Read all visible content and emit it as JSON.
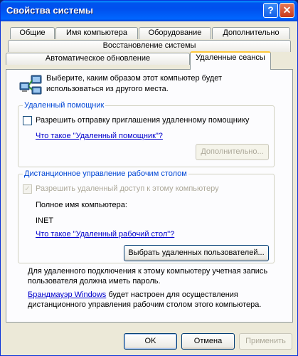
{
  "window": {
    "title": "Свойства системы"
  },
  "tabs_row1": [
    "Общие",
    "Имя компьютера",
    "Оборудование",
    "Дополнительно"
  ],
  "tabs_row2": [
    "Восстановление системы"
  ],
  "tabs_row3": [
    "Автоматическое обновление",
    "Удаленные сеансы"
  ],
  "active_tab": "Удаленные сеансы",
  "intro": {
    "line1": "Выберите, каким образом этот компьютер будет",
    "line2": "использоваться из другого места."
  },
  "assistance": {
    "title": "Удаленный помощник",
    "checkbox_label": "Разрешить отправку приглашения удаленному помощнику",
    "checked": false,
    "link": "Что такое \"Удаленный помощник\"?",
    "advanced_button": "Дополнительно..."
  },
  "remote_desktop": {
    "title": "Дистанционное управление рабочим столом",
    "checkbox_label": "Разрешить удаленный доступ к этому компьютеру",
    "checked": true,
    "full_name_label": "Полное имя компьютера:",
    "computer_name": "INET",
    "link": "Что такое \"Удаленный рабочий стол\"?",
    "select_users_button": "Выбрать удаленных пользователей..."
  },
  "notes": {
    "password_line1": "Для удаленного подключения к этому компьютеру учетная запись",
    "password_line2": "пользователя должна иметь пароль.",
    "firewall_link": "Брандмауэр Windows",
    "firewall_rest": " будет настроен для осуществления",
    "firewall_line2": "дистанционного управления рабочим столом этого компьютера."
  },
  "buttons": {
    "ok": "OK",
    "cancel": "Отмена",
    "apply": "Применить"
  }
}
